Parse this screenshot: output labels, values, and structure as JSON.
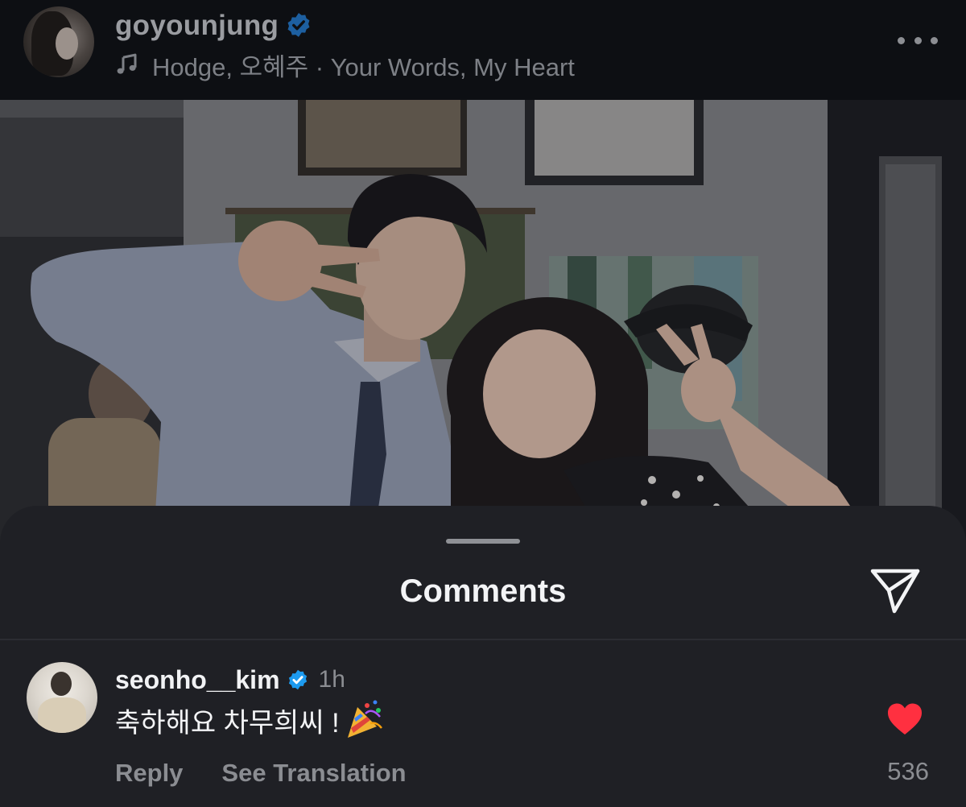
{
  "header": {
    "username": "goyounjung",
    "verified": true,
    "music": {
      "icon": "music-note-icon",
      "text": "Hodge, 오혜주 · Your Words, My Heart"
    },
    "more_icon": "more-horizontal-icon"
  },
  "post": {
    "image": "photo-two-people-peace-sign"
  },
  "comments_sheet": {
    "title": "Comments",
    "share_icon": "send-paper-plane-icon",
    "comment": {
      "username": "seonho__kim",
      "verified": true,
      "time": "1h",
      "text": "축하해요 차무희씨 !",
      "emoji": "party-popper-icon",
      "reply_label": "Reply",
      "translate_label": "See Translation",
      "like_count": "536",
      "liked": true
    }
  },
  "colors": {
    "verified_blue": "#1d9bf0",
    "like_red": "#ff3040",
    "sheet_bg": "#1f2025",
    "header_bg": "#0d0f13"
  }
}
